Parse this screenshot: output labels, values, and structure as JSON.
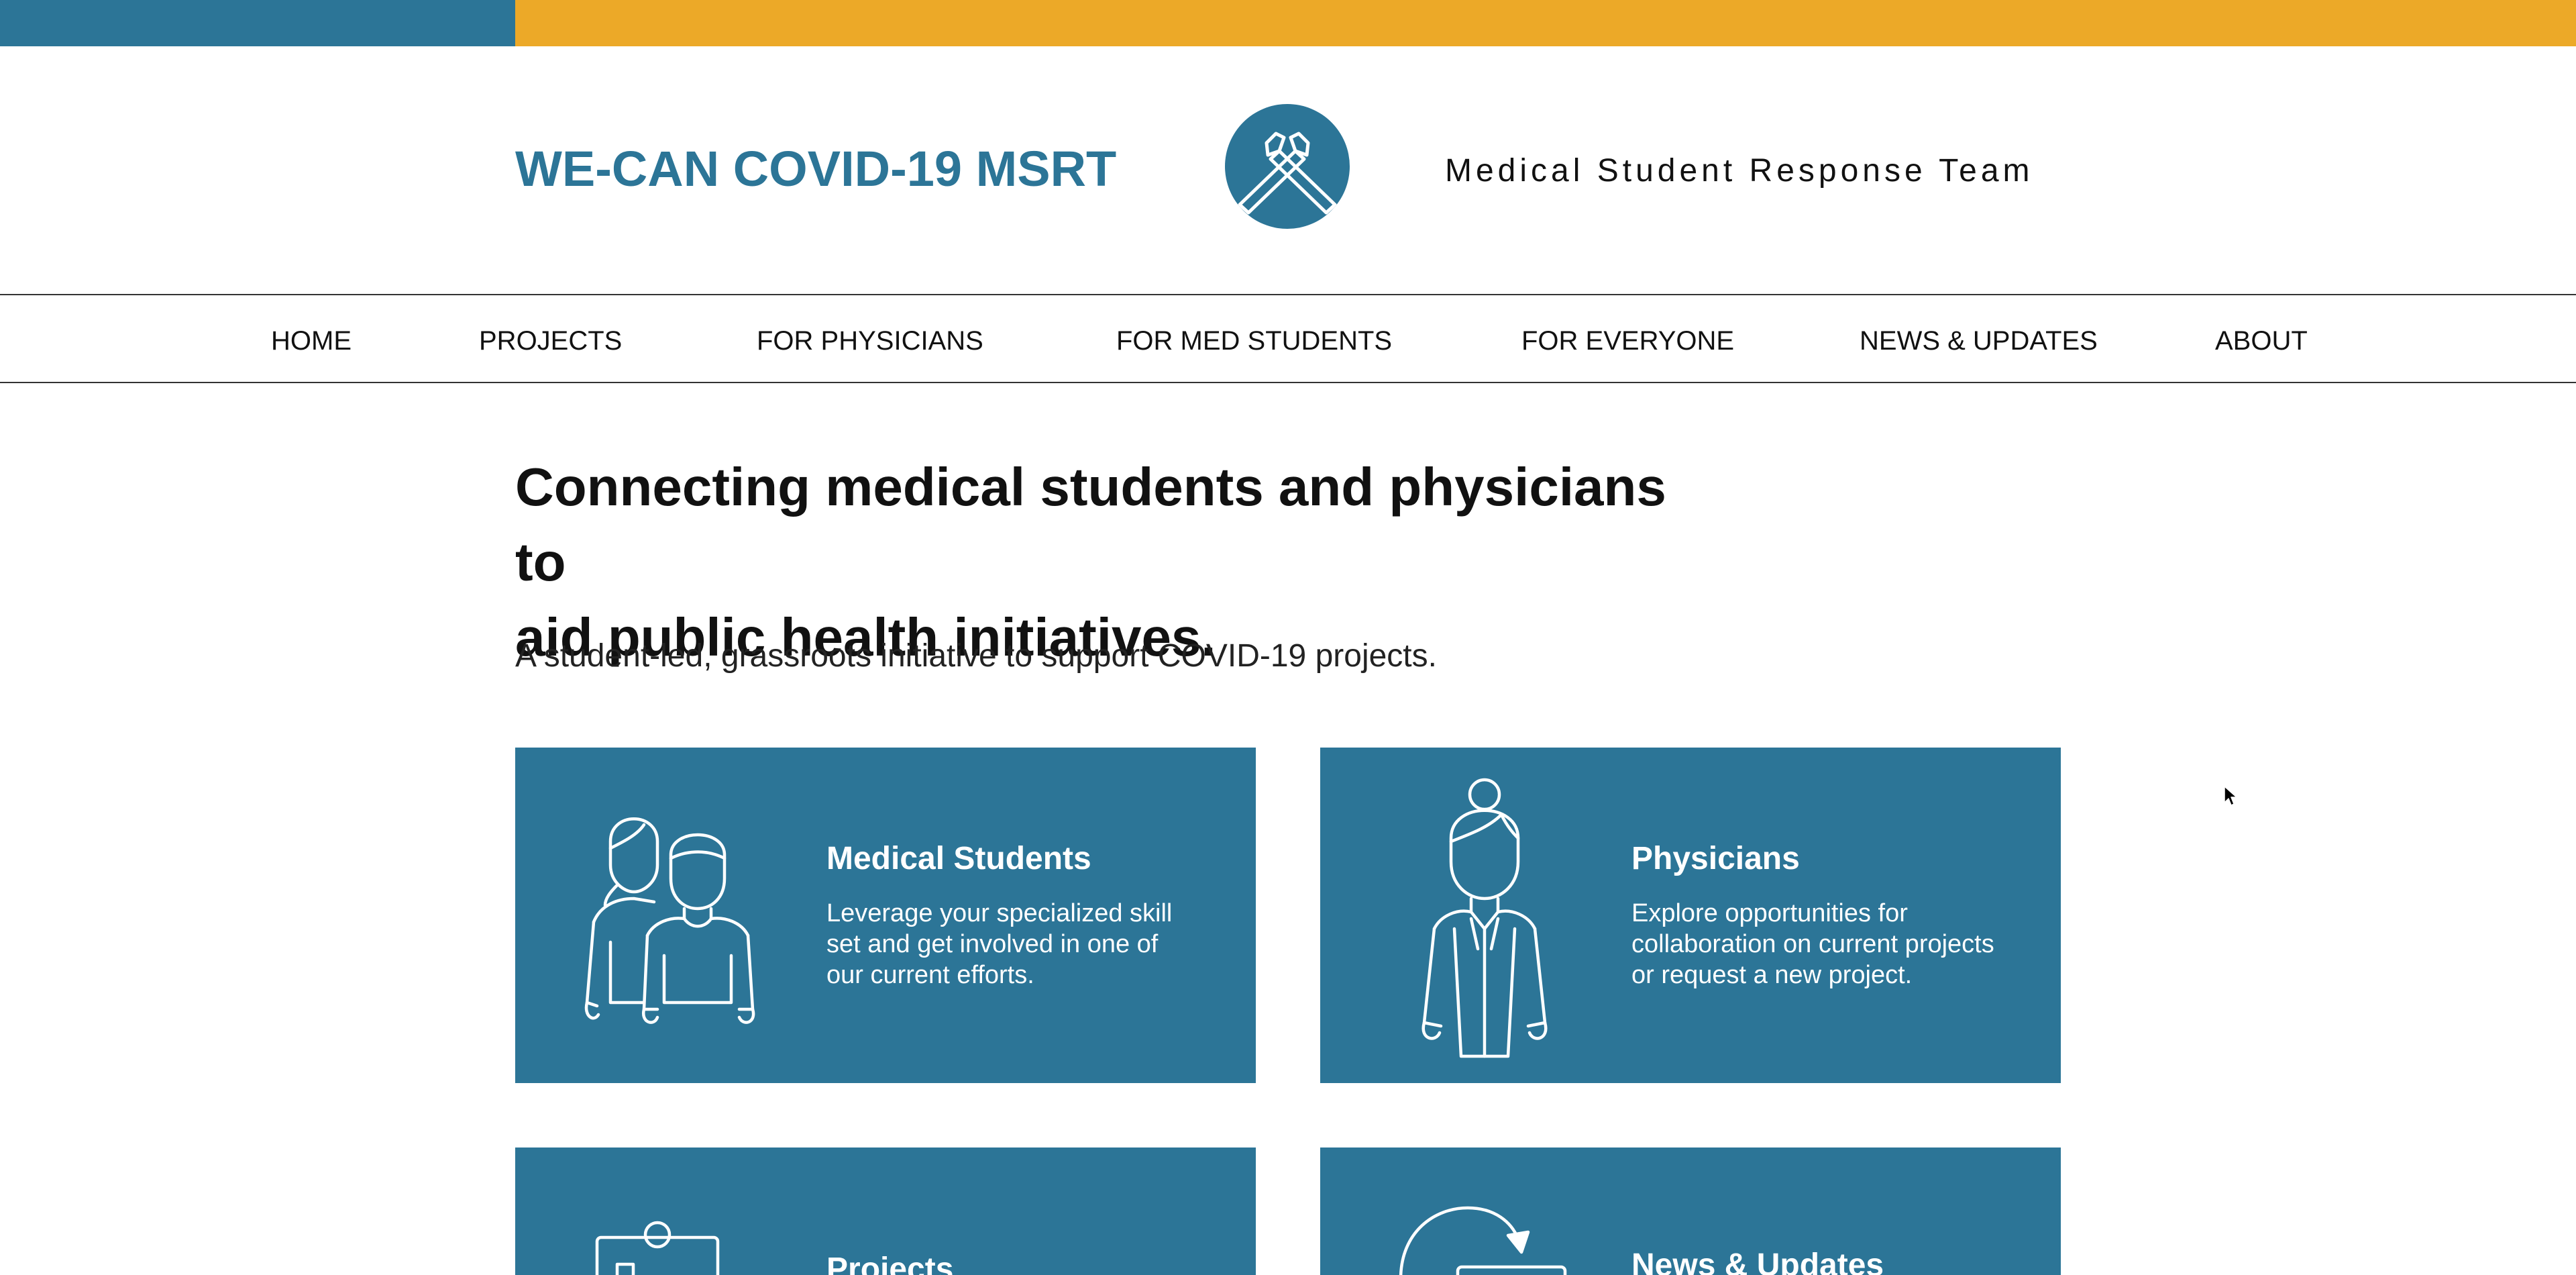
{
  "header": {
    "site_title": "WE-CAN COVID-19 MSRT",
    "logo_icon": "crossed-arms-icon",
    "tagline": "Medical Student Response Team"
  },
  "nav": {
    "items": [
      {
        "label": "HOME"
      },
      {
        "label": "PROJECTS"
      },
      {
        "label": "FOR PHYSICIANS"
      },
      {
        "label": "FOR MED STUDENTS"
      },
      {
        "label": "FOR EVERYONE"
      },
      {
        "label": "NEWS & UPDATES"
      },
      {
        "label": "ABOUT"
      }
    ]
  },
  "hero": {
    "headline_line1": "Connecting medical students and physicians to",
    "headline_line2": "aid public health initiatives.",
    "subhead": "A student-led, grassroots initiative to support COVID-19 projects."
  },
  "cards": [
    {
      "title": "Medical Students",
      "description_lines": [
        "Leverage your specialized skill",
        "set and get involved in one of",
        "our current efforts."
      ],
      "icon": "students-icon"
    },
    {
      "title": "Physicians",
      "description_lines": [
        "Explore opportunities for",
        "collaboration on current projects",
        "or request a new project."
      ],
      "icon": "physician-icon"
    },
    {
      "title": "Projects",
      "icon": "clipboard-icon"
    },
    {
      "title": "News & Updates",
      "icon": "refresh-icon"
    }
  ],
  "colors": {
    "brand_blue": "#2c7597",
    "brand_gold": "#eca928"
  }
}
